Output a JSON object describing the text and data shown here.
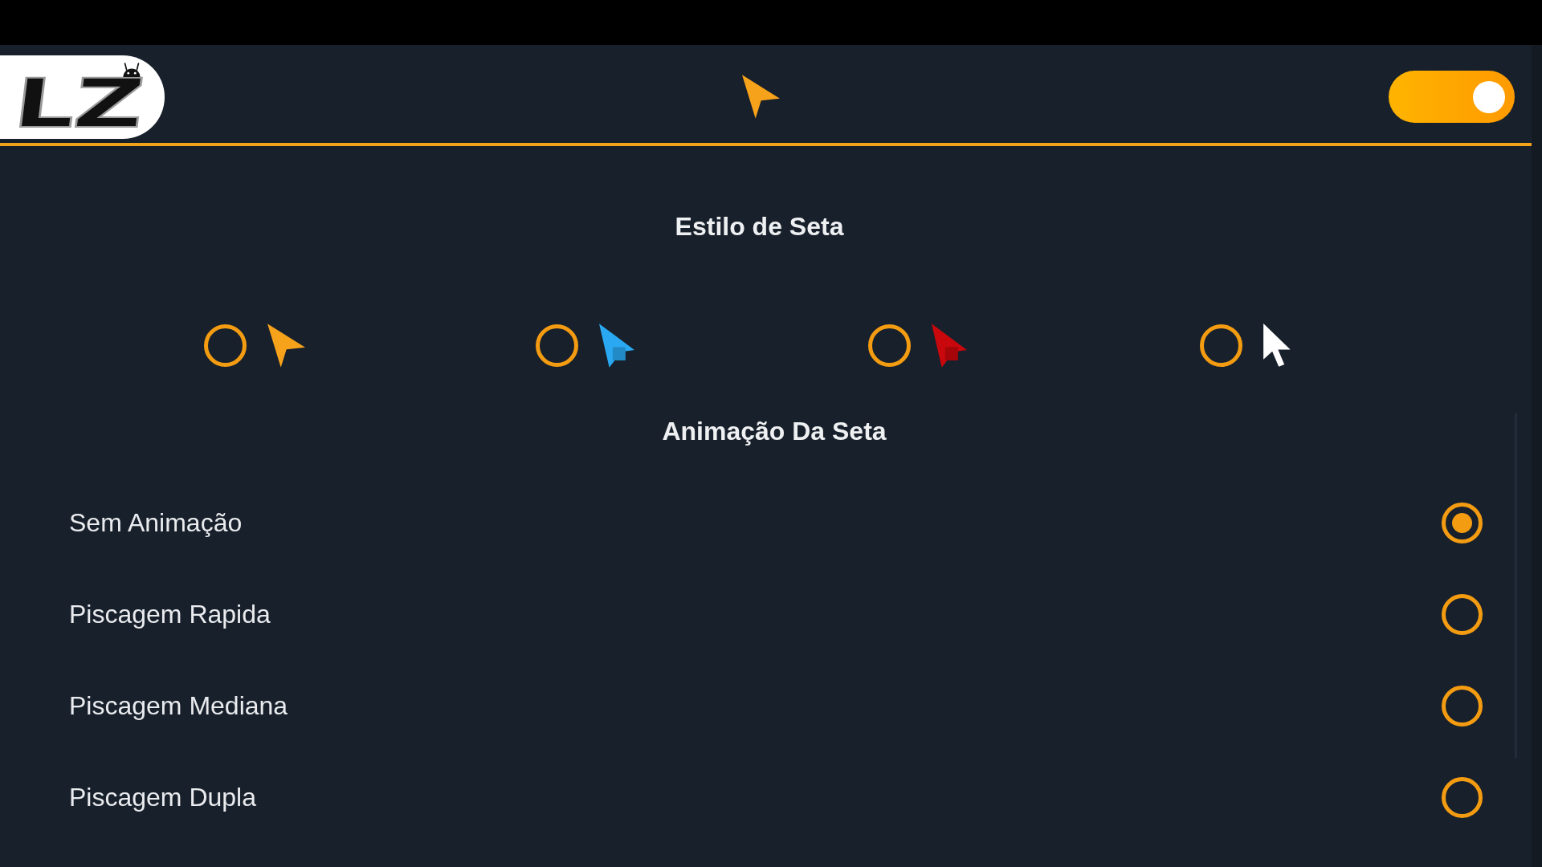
{
  "logo": {
    "text": "LZ"
  },
  "header": {
    "toggle": {
      "on": true
    }
  },
  "arrow_style": {
    "title": "Estilo de Seta",
    "options": [
      {
        "kind": "plain",
        "color": "#f7a21b",
        "selected": false
      },
      {
        "kind": "boxed",
        "color": "#2aa9f2",
        "selected": false
      },
      {
        "kind": "boxed",
        "color": "#c8080c",
        "selected": false
      },
      {
        "kind": "cursor",
        "color": "#ffffff",
        "selected": false
      }
    ]
  },
  "animation": {
    "title": "Animação Da Seta",
    "options": [
      {
        "label": "Sem Animação",
        "selected": true
      },
      {
        "label": "Piscagem Rapida",
        "selected": false
      },
      {
        "label": "Piscagem Mediana",
        "selected": false
      },
      {
        "label": "Piscagem Dupla",
        "selected": false
      }
    ]
  }
}
